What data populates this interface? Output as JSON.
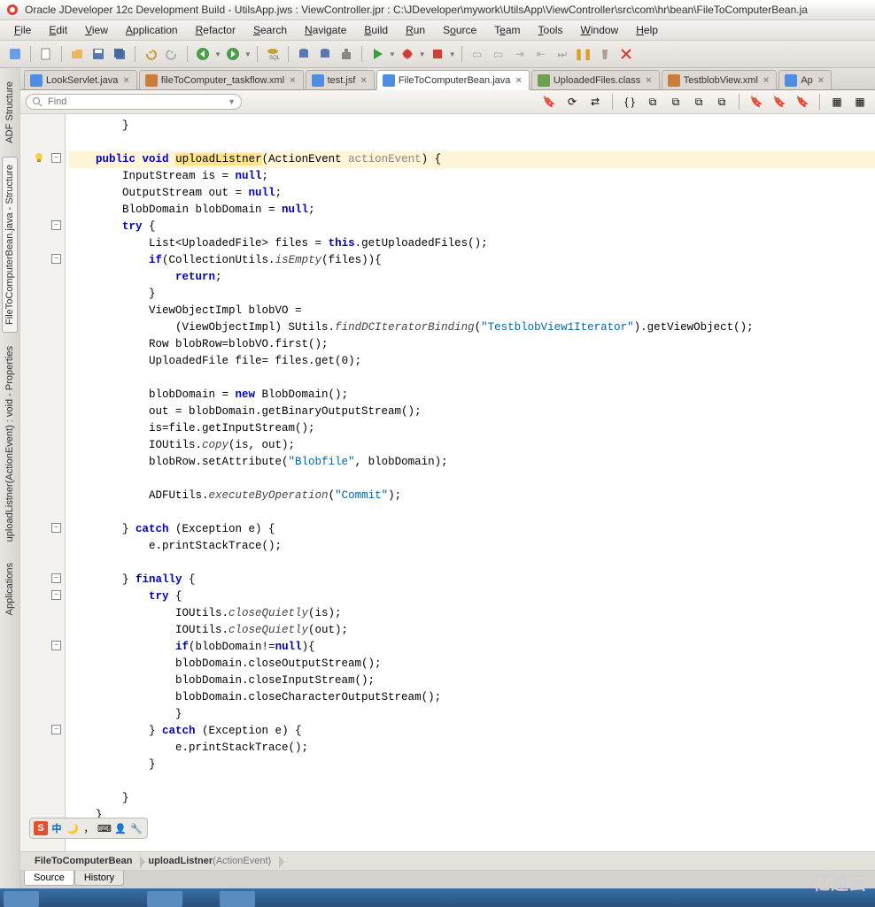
{
  "title": "Oracle JDeveloper 12c Development Build - UtilsApp.jws : ViewController.jpr : C:\\JDeveloper\\mywork\\UtilsApp\\ViewController\\src\\com\\hr\\bean\\FileToComputerBean.ja",
  "menu": [
    "File",
    "Edit",
    "View",
    "Application",
    "Refactor",
    "Search",
    "Navigate",
    "Build",
    "Run",
    "Source",
    "Team",
    "Tools",
    "Window",
    "Help"
  ],
  "menu_accel": [
    0,
    0,
    0,
    0,
    0,
    0,
    0,
    0,
    0,
    1,
    1,
    0,
    0,
    0
  ],
  "vtabs_left1": [
    "ADF Structure",
    "FileToComputerBean.java - Structure"
  ],
  "vtabs_left2": [
    "uploadListner(ActionEvent) : void - Properties",
    "Applications"
  ],
  "tabs": [
    {
      "label": "LookServlet.java",
      "icon": "java",
      "active": false
    },
    {
      "label": "fileToComputer_taskflow.xml",
      "icon": "xml",
      "active": false
    },
    {
      "label": "test.jsf",
      "icon": "java",
      "active": false
    },
    {
      "label": "FileToComputerBean.java",
      "icon": "java",
      "active": true
    },
    {
      "label": "UploadedFiles.class",
      "icon": "cls",
      "active": false
    },
    {
      "label": "TestblobView.xml",
      "icon": "xml",
      "active": false
    },
    {
      "label": "Ap",
      "icon": "java",
      "active": false
    }
  ],
  "find_placeholder": "Find",
  "code_lines": [
    {
      "t": "        }",
      "fold": null
    },
    {
      "t": "",
      "fold": null
    },
    {
      "t": "    public void uploadListner(ActionEvent actionEvent) {",
      "fold": "-",
      "hl": true
    },
    {
      "t": "        InputStream is = null;"
    },
    {
      "t": "        OutputStream out = null;"
    },
    {
      "t": "        BlobDomain blobDomain = null;"
    },
    {
      "t": "        try {",
      "fold": "-"
    },
    {
      "t": "            List<UploadedFile> files = this.getUploadedFiles();"
    },
    {
      "t": "            if(CollectionUtils.isEmpty(files)){",
      "fold": "-"
    },
    {
      "t": "                return;"
    },
    {
      "t": "            }"
    },
    {
      "t": "            ViewObjectImpl blobVO ="
    },
    {
      "t": "                (ViewObjectImpl) SUtils.findDCIteratorBinding(\"TestblobView1Iterator\").getViewObject();"
    },
    {
      "t": "            Row blobRow=blobVO.first();"
    },
    {
      "t": "            UploadedFile file= files.get(0);"
    },
    {
      "t": ""
    },
    {
      "t": "            blobDomain = new BlobDomain();"
    },
    {
      "t": "            out = blobDomain.getBinaryOutputStream();"
    },
    {
      "t": "            is=file.getInputStream();"
    },
    {
      "t": "            IOUtils.copy(is, out);"
    },
    {
      "t": "            blobRow.setAttribute(\"Blobfile\", blobDomain);"
    },
    {
      "t": ""
    },
    {
      "t": "            ADFUtils.executeByOperation(\"Commit\");"
    },
    {
      "t": ""
    },
    {
      "t": "        } catch (Exception e) {",
      "fold": "-"
    },
    {
      "t": "            e.printStackTrace();"
    },
    {
      "t": ""
    },
    {
      "t": "        } finally {",
      "fold": "-"
    },
    {
      "t": "            try {",
      "fold": "-"
    },
    {
      "t": "                IOUtils.closeQuietly(is);"
    },
    {
      "t": "                IOUtils.closeQuietly(out);"
    },
    {
      "t": "                if(blobDomain!=null){",
      "fold": "-"
    },
    {
      "t": "                blobDomain.closeOutputStream();"
    },
    {
      "t": "                blobDomain.closeInputStream();"
    },
    {
      "t": "                blobDomain.closeCharacterOutputStream();"
    },
    {
      "t": "                }"
    },
    {
      "t": "            } catch (Exception e) {",
      "fold": "-"
    },
    {
      "t": "                e.printStackTrace();"
    },
    {
      "t": "            }"
    },
    {
      "t": ""
    },
    {
      "t": "        }"
    },
    {
      "t": "    }"
    }
  ],
  "breadcrumbs": [
    {
      "label": "FileToComputerBean"
    },
    {
      "label": "uploadListner(ActionEvent)"
    }
  ],
  "bottom_tabs": [
    "Source",
    "History"
  ],
  "ime": [
    "中",
    "🌙",
    "",
    "⌨",
    "👤",
    "🔧"
  ],
  "watermark": "亿速云"
}
